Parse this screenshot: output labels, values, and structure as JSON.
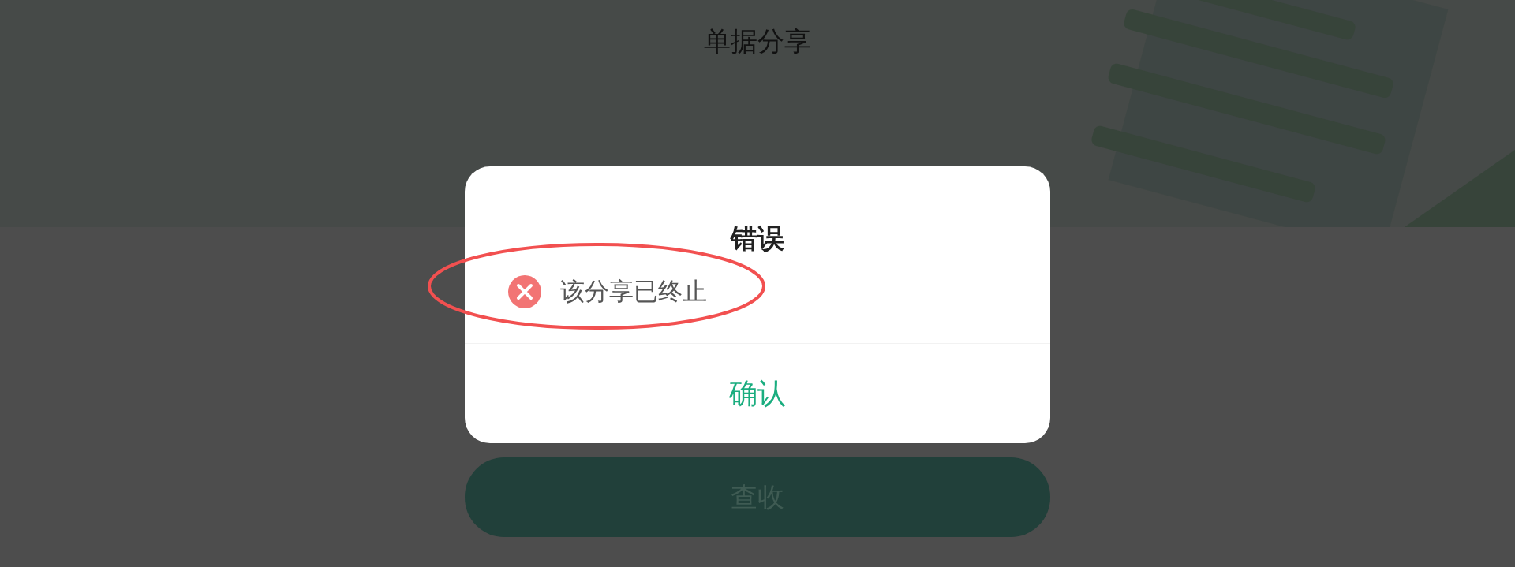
{
  "header": {
    "title": "单据分享"
  },
  "dialog": {
    "title": "错误",
    "message": {
      "kind": "error",
      "text": "该分享已终止"
    },
    "confirm": {
      "label": "确认"
    }
  },
  "primary_button": {
    "label": "查收"
  }
}
